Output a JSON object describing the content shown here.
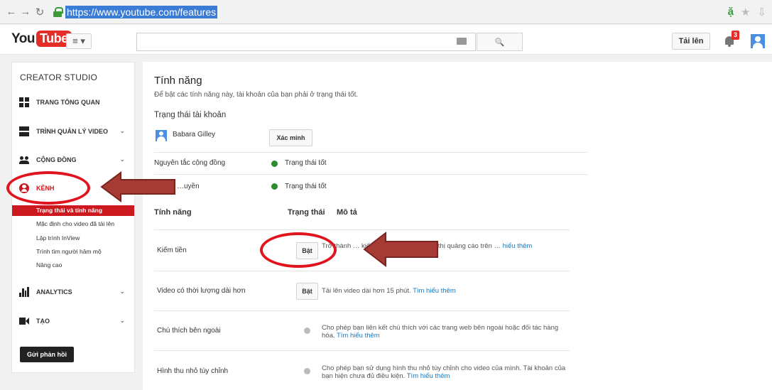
{
  "browser": {
    "url": "https://www.youtube.com/features",
    "back_glyph": "←",
    "forward_glyph": "→",
    "reload_glyph": "↻",
    "ext_glyph": "ặ",
    "star_glyph": "★",
    "download_glyph": "⇩"
  },
  "masthead": {
    "logo_you": "You",
    "logo_tube": "Tube",
    "guide_glyph": "≡ ▾",
    "search_placeholder": "",
    "search_glyph": "🔍",
    "upload_label": "Tải lên",
    "notification_count": "3"
  },
  "sidebar": {
    "title": "CREATOR STUDIO",
    "items": [
      {
        "label": "TRANG TỔNG QUAN"
      },
      {
        "label": "TRÌNH QUẢN LÝ VIDEO"
      },
      {
        "label": "CỘNG ĐỒNG"
      },
      {
        "label": "KÊNH"
      },
      {
        "label": "ANALYTICS"
      },
      {
        "label": "TẠO"
      }
    ],
    "chevron": "⌄",
    "channel_sub_items": [
      {
        "label": "Trạng thái và tính năng",
        "active": true
      },
      {
        "label": "Mặc định cho video đã tải lên"
      },
      {
        "label": "Lập trình InView"
      },
      {
        "label": "Trình tìm người hâm mộ"
      },
      {
        "label": "Nâng cao"
      }
    ],
    "feedback_label": "Gửi phản hồi"
  },
  "main": {
    "title": "Tính năng",
    "description": "Để bật các tính năng này, tài khoản của bạn phải ở trạng thái tốt.",
    "account_heading": "Trạng thái tài khoản",
    "user_name": "Babara Gilley",
    "verify_label": "Xác minh",
    "statuses": [
      {
        "label": "Nguyên tắc cộng đồng",
        "value": "Trạng thái tốt"
      },
      {
        "label": "…uyền",
        "value": "Trạng thái tốt"
      }
    ],
    "table_headers": {
      "feature": "Tính năng",
      "status": "Trạng thái",
      "description": "Mô tả"
    },
    "features": [
      {
        "name": "Kiếm tiền",
        "button": "Bật",
        "desc": "Trở thành … kiếm tiền bằng cách hiển thị quảng cáo trên …",
        "learn": "hiểu thêm"
      },
      {
        "name": "Video có thời lượng dài hơn",
        "button": "Bật",
        "desc": "Tải lên video dài hơn 15 phút.",
        "learn": "Tìm hiểu thêm"
      },
      {
        "name": "Chú thích bên ngoài",
        "button": "",
        "desc": "Cho phép bạn liên kết chú thích với các trang web bên ngoài hoặc đối tác hàng hóa.",
        "learn": "Tìm hiểu thêm"
      },
      {
        "name": "Hình thu nhỏ tùy chỉnh",
        "button": "",
        "desc": "Cho phép bạn sử dụng hình thu nhỏ tùy chỉnh cho video của mình. Tài khoản của bạn hiện chưa đủ điều kiện.",
        "learn": "Tìm hiểu thêm"
      }
    ]
  },
  "colors": {
    "brand_red": "#e52d27",
    "sidebar_active": "#cc181e",
    "status_good": "#2e8b2e",
    "link": "#167ac6",
    "annotation_red": "#e0141e",
    "arrow_fill": "#a63a35"
  }
}
